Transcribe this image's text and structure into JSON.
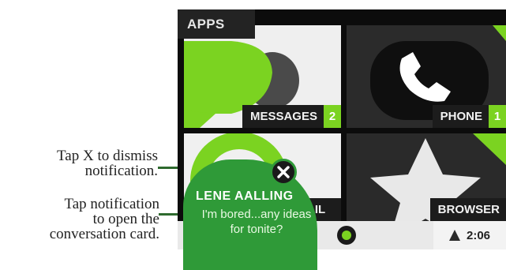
{
  "callouts": {
    "dismiss": [
      "Tap X to dismiss",
      "notification."
    ],
    "open": [
      "Tap notification",
      "to open the",
      "conversation card."
    ]
  },
  "apps_label": "APPS",
  "tiles": {
    "messages": {
      "label": "MESSAGES",
      "count": "2"
    },
    "phone": {
      "label": "PHONE",
      "count": "1"
    },
    "email": {
      "label": "AIL"
    },
    "browser": {
      "label": "BROWSER"
    }
  },
  "notification": {
    "name": "LENE AALLING",
    "message": "I'm bored...any ideas for tonite?"
  },
  "status": {
    "time": "2:06"
  },
  "colors": {
    "accent": "#7bd321",
    "notification": "#2f9a38",
    "screen": "#0c0c0c"
  }
}
